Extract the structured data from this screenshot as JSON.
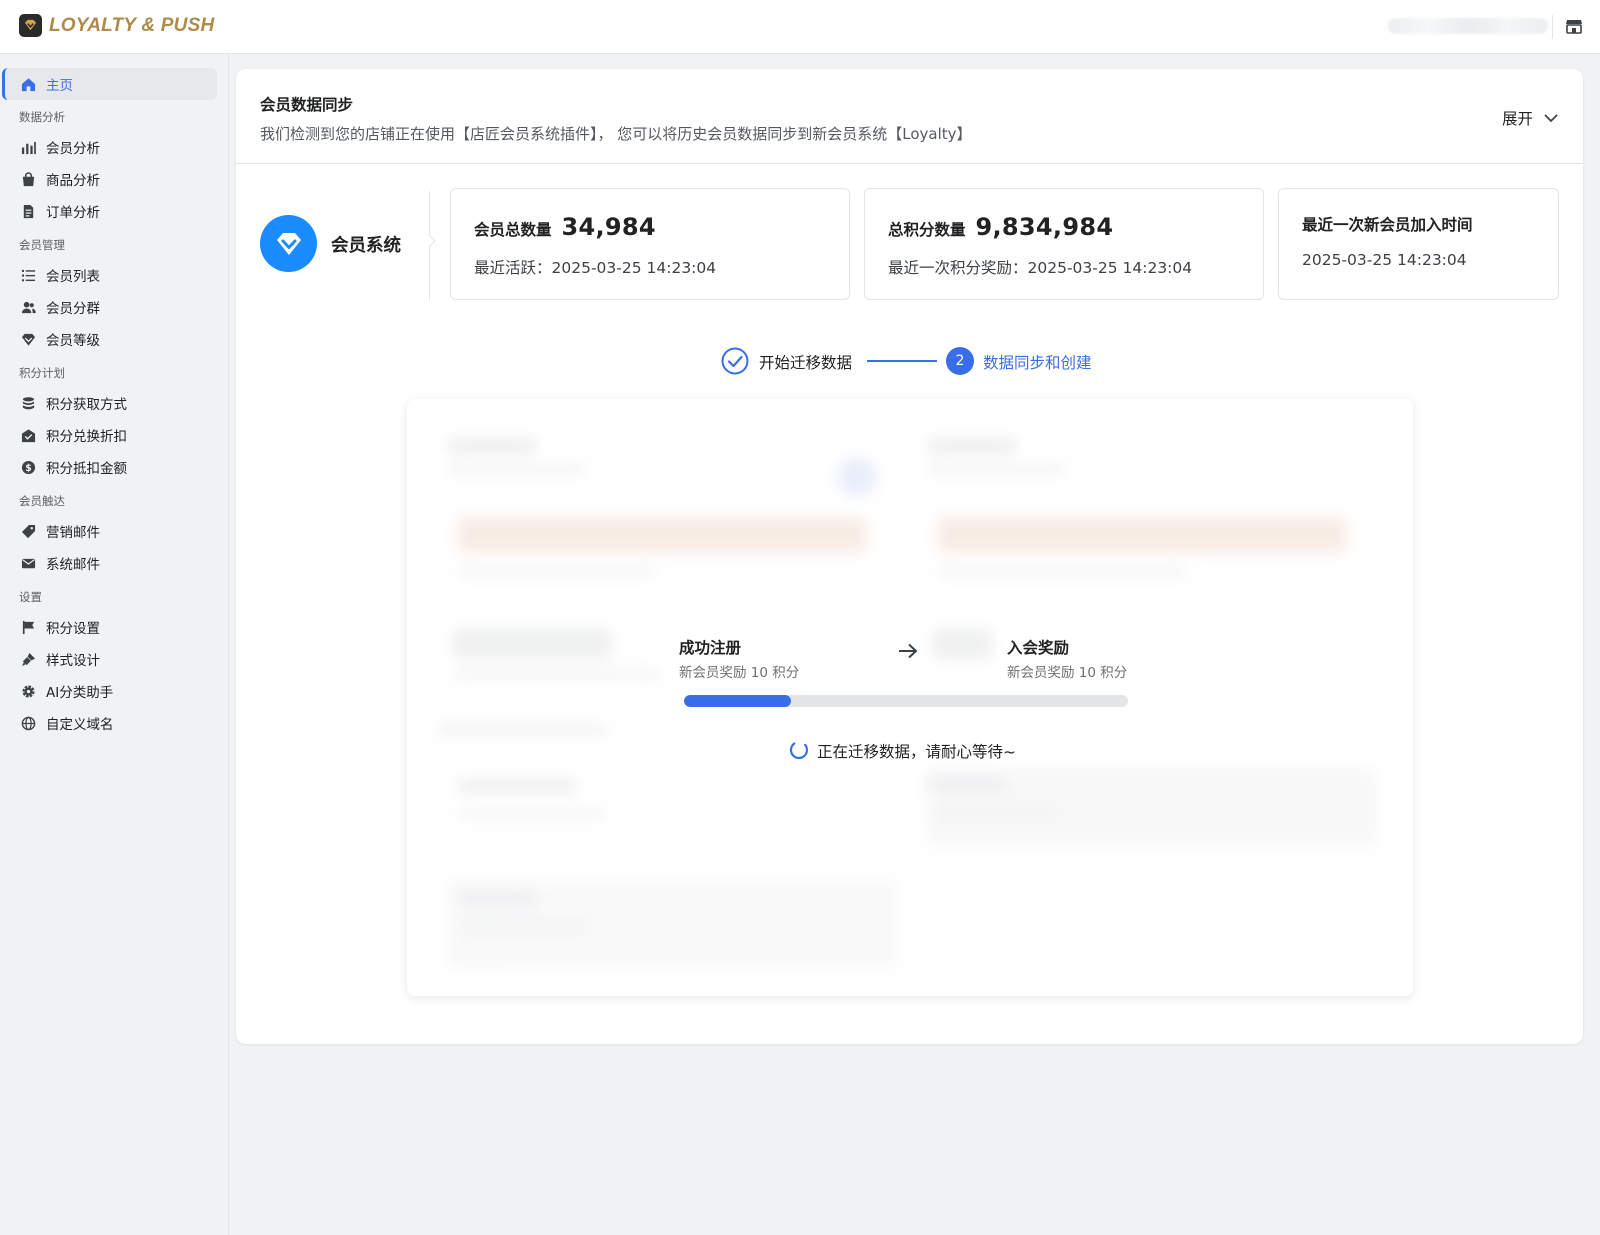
{
  "app": {
    "logo_text": "LOYALTY & PUSH",
    "accent_color": "#3a6ee8",
    "logo_color": "#b08a48"
  },
  "sidebar": {
    "home": {
      "label": "主页",
      "icon": "home-icon"
    },
    "sections": [
      {
        "title": "数据分析",
        "items": [
          {
            "label": "会员分析",
            "icon": "bar-chart-icon"
          },
          {
            "label": "商品分析",
            "icon": "shopping-bag-icon"
          },
          {
            "label": "订单分析",
            "icon": "document-icon"
          }
        ]
      },
      {
        "title": "会员管理",
        "items": [
          {
            "label": "会员列表",
            "icon": "list-icon"
          },
          {
            "label": "会员分群",
            "icon": "users-icon"
          },
          {
            "label": "会员等级",
            "icon": "diamond-icon"
          }
        ]
      },
      {
        "title": "积分计划",
        "items": [
          {
            "label": "积分获取方式",
            "icon": "database-icon"
          },
          {
            "label": "积分兑换折扣",
            "icon": "discount-icon"
          },
          {
            "label": "积分抵扣金额",
            "icon": "dollar-icon"
          }
        ]
      },
      {
        "title": "会员触达",
        "items": [
          {
            "label": "营销邮件",
            "icon": "tag-icon"
          },
          {
            "label": "系统邮件",
            "icon": "mail-icon"
          }
        ]
      },
      {
        "title": "设置",
        "items": [
          {
            "label": "积分设置",
            "icon": "flag-icon"
          },
          {
            "label": "样式设计",
            "icon": "brush-icon"
          },
          {
            "label": "AI分类助手",
            "icon": "gear-icon"
          },
          {
            "label": "自定义域名",
            "icon": "globe-icon"
          }
        ]
      }
    ]
  },
  "sync": {
    "title": "会员数据同步",
    "description": "我们检测到您的店铺正在使用【店匠会员系统插件】， 您可以将历史会员数据同步到新会员系统【Loyalty】",
    "expand_label": "展开",
    "system_name": "会员系统"
  },
  "stats": [
    {
      "key": "会员总数量",
      "value": "34,984",
      "detail": "最近活跃：2025-03-25 14:23:04"
    },
    {
      "key": "总积分数量",
      "value": "9,834,984",
      "detail": "最近一次积分奖励：2025-03-25 14:23:04"
    },
    {
      "key": "最近一次新会员加入时间",
      "value": "",
      "detail": "2025-03-25 14:23:04"
    }
  ],
  "stepper": {
    "step1": "开始迁移数据",
    "step2_number": "2",
    "step2": "数据同步和创建"
  },
  "migration": {
    "from_title": "成功注册",
    "from_sub": "新会员奖励 10 积分",
    "to_title": "入会奖励",
    "to_sub": "新会员奖励 10 积分",
    "progress": 0.24,
    "status": "正在迁移数据，请耐心等待~"
  }
}
